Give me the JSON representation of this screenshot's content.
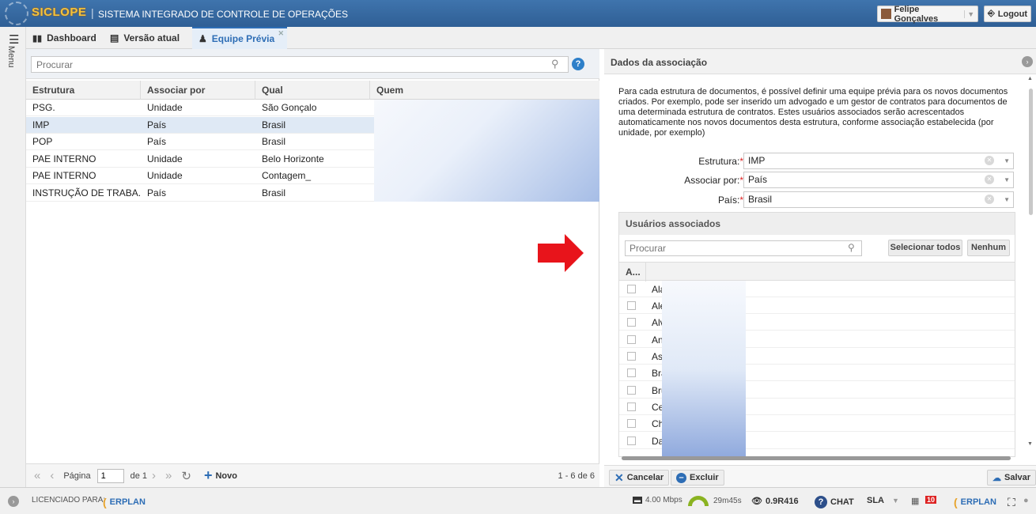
{
  "header": {
    "brand": "SICLOPE",
    "separator": "|",
    "system_title": "SISTEMA INTEGRADO DE CONTROLE DE OPERAÇÕES",
    "user_name": "Felipe Gonçalves",
    "logout_label": "Logout"
  },
  "rail": {
    "menu_label": "Menu"
  },
  "tabs": [
    {
      "label": "Dashboard"
    },
    {
      "label": "Versão atual"
    },
    {
      "label": "Equipe Prévia"
    }
  ],
  "list": {
    "search_placeholder": "Procurar",
    "columns": [
      "Estrutura",
      "Associar por",
      "Qual",
      "Quem"
    ],
    "rows": [
      [
        "PSG.",
        "Unidade",
        "São Gonçalo"
      ],
      [
        "IMP",
        "País",
        "Brasil"
      ],
      [
        "POP",
        "País",
        "Brasil"
      ],
      [
        "PAE INTERNO",
        "Unidade",
        "Belo Horizonte"
      ],
      [
        "PAE INTERNO",
        "Unidade",
        "Contagem_"
      ],
      [
        "INSTRUÇÃO DE TRABA...",
        "País",
        "Brasil"
      ]
    ],
    "pager": {
      "page_label": "Página",
      "page_value": "1",
      "of_label": "de 1",
      "new_label": "Novo",
      "range": "1 - 6 de 6"
    }
  },
  "detail": {
    "title": "Dados da associação",
    "description": "Para cada estrutura de documentos, é possível definir uma equipe prévia para os novos documentos criados. Por exemplo, pode ser inserido um advogado e um gestor de contratos para documentos de uma determinada estrutura de contratos. Estes usuários associados serão acrescentados automaticamente nos novos documentos desta estrutura, conforme associação estabelecida (por unidade, por exemplo)",
    "fields": [
      {
        "label": "Estrutura:",
        "value": "IMP"
      },
      {
        "label": "Associar por:",
        "value": "País"
      },
      {
        "label": "País:",
        "value": "Brasil"
      }
    ],
    "users": {
      "title": "Usuários associados",
      "search_placeholder": "Procurar",
      "select_all_label": "Selecionar todos",
      "none_label": "Nenhum",
      "column": "A...",
      "names": [
        "Ala",
        "Ale",
        "Alv",
        "An",
        "As",
        "Bra",
        "Bru",
        "Ce",
        "Ch",
        "Da"
      ]
    },
    "cancel_label": "Cancelar",
    "delete_label": "Excluir",
    "save_label": "Salvar"
  },
  "status": {
    "licensed_label": "LICENCIADO PARA:",
    "erplan_left": "ERPLAN",
    "speed": "4.00 Mbps",
    "time": "29m45s",
    "version": "0.9R416",
    "chat": "CHAT",
    "sla": "SLA",
    "badge": "10",
    "erplan_right": "ERPLAN"
  },
  "colors": {
    "header": "#3f74ad",
    "accent": "#2d6db5",
    "brand": "#f5c23a",
    "arrow": "#e8141b"
  }
}
